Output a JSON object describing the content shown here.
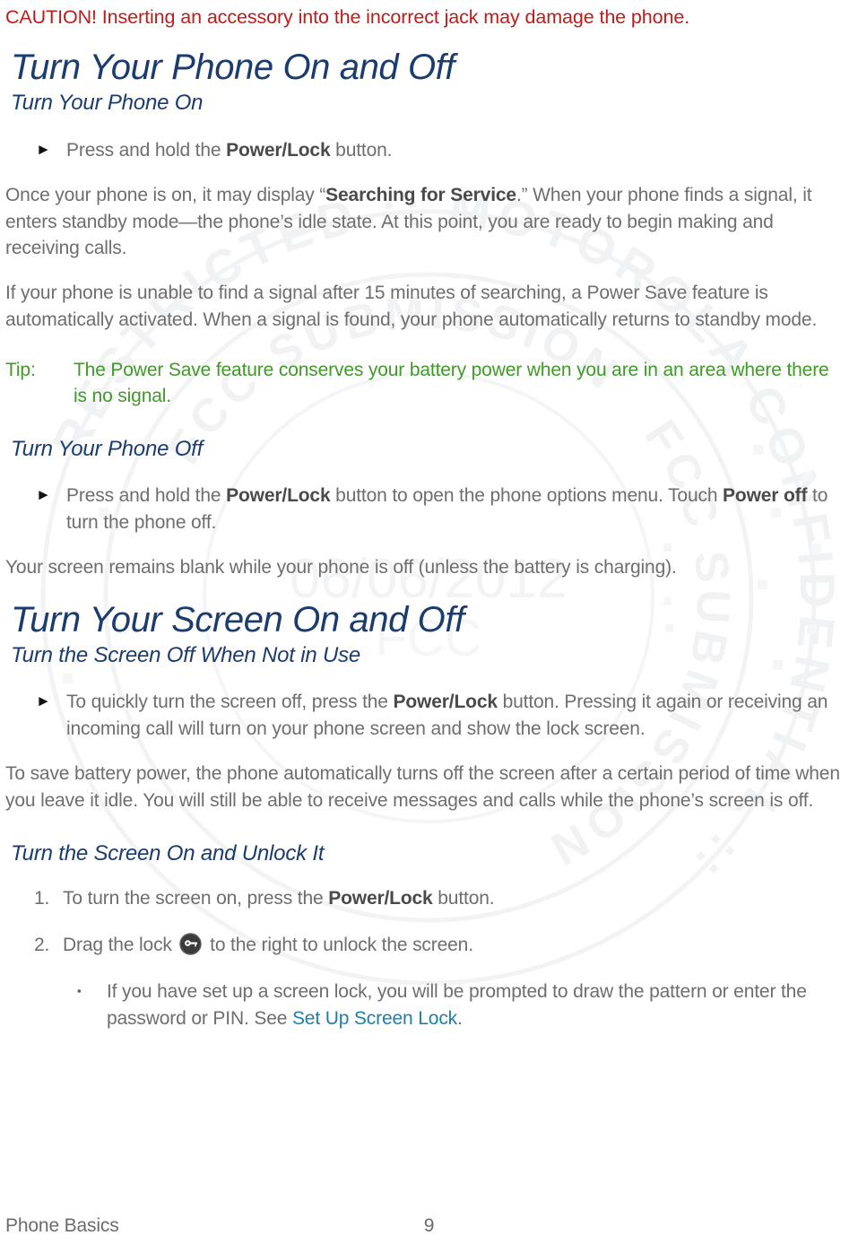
{
  "document": {
    "title": "Turn Your Phone On and Off",
    "page_number": "9",
    "footer_section": "Phone Basics"
  },
  "watermark": {
    "outer_ring_text": "RESTRICTED :: MOTOROLA CONFIDENTIAL",
    "inner_ring_text": "FCC SUBMISSION",
    "date": "06/06/2012",
    "agency": "FCC",
    "color": "#e9ebee"
  },
  "colors": {
    "heading": "#1b3c6e",
    "body": "#6e6e6e",
    "caution": "#bf1b1b",
    "tip": "#3f9a27",
    "link": "#1d80ac",
    "bold": "#4a4a4a"
  },
  "caution": {
    "text": "CAUTION! Inserting an accessory into the incorrect jack may damage the phone."
  },
  "sections": [
    {
      "heading": "Turn Your Phone On and Off",
      "subheading": "Turn Your Phone On"
    },
    {
      "heading": "Turn Your Screen On and Off",
      "subheading": "Turn the Screen Off When Not in Use"
    }
  ],
  "subheadings": {
    "phone_off": "Turn Your Phone Off",
    "screen_unlock": "Turn the Screen On and Unlock It"
  },
  "bullets": {
    "power_on": {
      "marker": "►",
      "pre": "Press and hold the ",
      "bold": "Power/Lock",
      "post": " button."
    },
    "power_off": {
      "marker": "►",
      "pre": "Press and hold the ",
      "bold1": "Power/Lock",
      "mid": " button to open the phone options menu. Touch ",
      "bold2": "Power off",
      "post": " to turn the phone off."
    },
    "screen_off": {
      "marker": "►",
      "pre": "To quickly turn the screen off, press the ",
      "bold": "Power/Lock",
      "post": " button. Pressing it again or receiving an incoming call will turn on your phone screen and show the lock screen."
    }
  },
  "paragraphs": {
    "after_power_on_1": {
      "pre": "Once your phone is on, it may display “",
      "bold": "Searching for Service",
      "post": ".” When your phone finds a signal, it enters standby mode—the phone’s idle state. At this point, you are ready to begin making and receiving calls."
    },
    "after_power_on_2": "If your phone is unable to find a signal after 15 minutes of searching, a Power Save feature is automatically activated. When a signal is found, your phone automatically returns to standby mode.",
    "after_power_off": "Your screen remains blank while your phone is off (unless the battery is charging).",
    "after_screen_off": "To save battery power, the phone automatically turns off the screen after a certain period of time when you leave it idle. You will still be able to receive messages and calls while the phone’s screen is off."
  },
  "tip": {
    "label": "Tip:",
    "text": "The Power Save feature conserves your battery power when you are in an area where there is no signal."
  },
  "numbered_list": [
    {
      "marker": "1.",
      "pre": "To turn the screen on, press the ",
      "bold": "Power/Lock",
      "post": " button."
    },
    {
      "marker": "2.",
      "pre": "Drag the lock ",
      "icon": "lock-key-icon",
      "post": " to the right to unlock the screen."
    }
  ],
  "sub_bullet": {
    "marker": "▪",
    "pre": "If you have set up a screen lock, you will be prompted to draw the pattern or enter the password or PIN. See ",
    "link": "Set Up Screen Lock",
    "post": "."
  }
}
